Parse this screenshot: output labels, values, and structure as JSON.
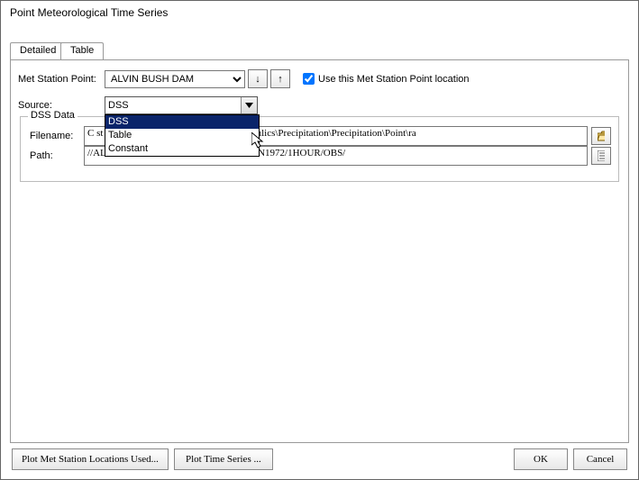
{
  "title": "Point Meteorological Time Series",
  "tabs": {
    "detailed": "Detailed",
    "table": "Table"
  },
  "station_point": {
    "label": "Met Station Point:",
    "value": "ALVIN BUSH DAM",
    "use_location_label": "Use this Met Station Point location",
    "use_location_checked": true
  },
  "source": {
    "label": "Source:",
    "value": "DSS",
    "options": [
      "DSS",
      "Table",
      "Constant"
    ]
  },
  "dss": {
    "group_title": "DSS Data",
    "filename_label": "Filename:",
    "filename_value": "C                                                          st Datasets 51\\2D Unsteady Flow Hydraulics\\Precipitation\\Precipitation\\Point\\ra",
    "path_label": "Path:",
    "path_value": "//ALVIN BUSH DAM/PRECIP-INC/01JUN1972/1HOUR/OBS/"
  },
  "buttons": {
    "plot_locations": "Plot Met Station Locations Used...",
    "plot_ts": "Plot Time Series ...",
    "ok": "OK",
    "cancel": "Cancel"
  }
}
